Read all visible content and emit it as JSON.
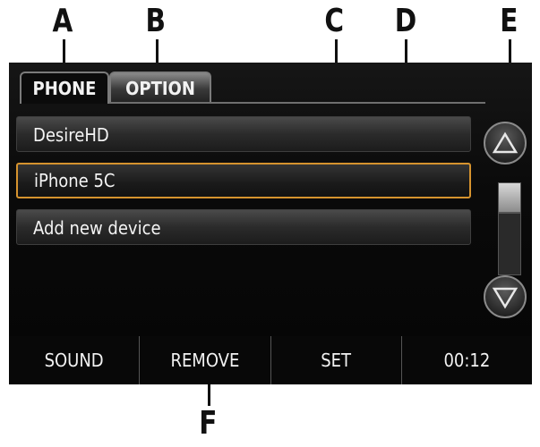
{
  "callouts": [
    "A",
    "B",
    "C",
    "D",
    "E",
    "F"
  ],
  "tabs": {
    "phone": "PHONE",
    "option": "OPTION"
  },
  "devices": [
    {
      "label": "DesireHD",
      "selected": false
    },
    {
      "label": "iPhone 5C",
      "selected": true
    },
    {
      "label": "Add new device",
      "selected": false
    }
  ],
  "scroll": {
    "up_icon": "triangle-up",
    "down_icon": "triangle-down"
  },
  "bottom_bar": {
    "sound": "SOUND",
    "remove": "REMOVE",
    "set": "SET",
    "time": "00:12"
  },
  "colors": {
    "selection_border": "#d6932e",
    "screen_bg": "#0a0a0a"
  }
}
